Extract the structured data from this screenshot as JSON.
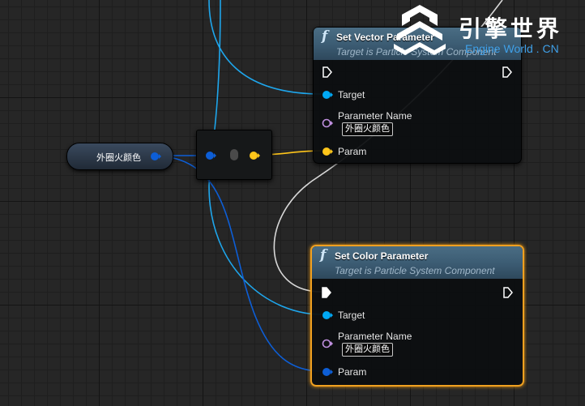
{
  "watermark": {
    "chinese": "引擎世界",
    "english": "Engine World . CN"
  },
  "variable_node": {
    "label": "外圈火颜色"
  },
  "node_vector": {
    "title": "Set Vector Parameter",
    "subtitle": "Target is Particle System Component",
    "pins": {
      "target": "Target",
      "param_name": "Parameter Name",
      "param_name_value": "外圈火颜色",
      "param": "Param"
    }
  },
  "node_color": {
    "title": "Set Color Parameter",
    "subtitle": "Target is Particle System Component",
    "pins": {
      "target": "Target",
      "param_name": "Parameter Name",
      "param_name_value": "外圈火颜色",
      "param": "Param"
    }
  },
  "colors": {
    "object_pin": "#00a8f4",
    "name_pin": "#c090e0",
    "vector_pin": "#ffc51a",
    "color_pin": "#0d5ed6",
    "exec_wire": "#e6e6e6",
    "selection": "#f0a020"
  }
}
